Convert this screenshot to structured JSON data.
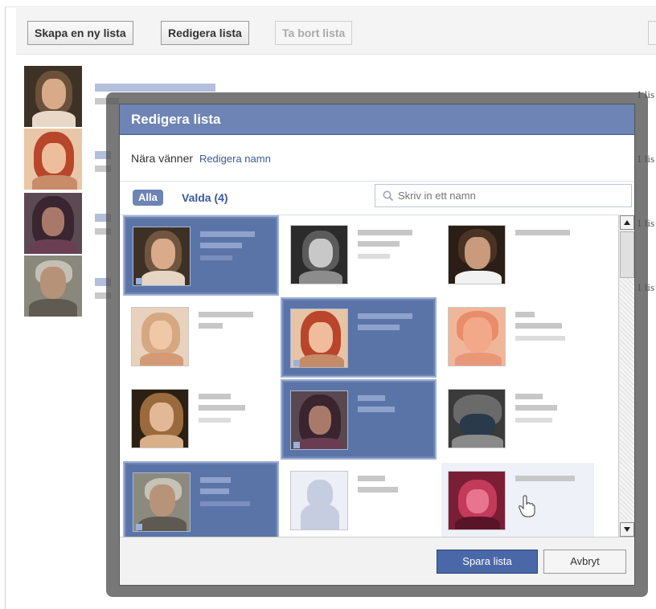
{
  "toolbar": {
    "create_label": "Skapa en ny lista",
    "edit_label": "Redigera lista",
    "delete_label": "Ta bort lista"
  },
  "background_list": {
    "counts": [
      "1 lis",
      "1 lis",
      "1 lis",
      "1 lis"
    ]
  },
  "dialog": {
    "title": "Redigera lista",
    "list_name": "Nära vänner",
    "rename_link": "Redigera namn",
    "filter_all": "Alla",
    "filter_selected": "Valda (4)",
    "search_placeholder": "Skriv in ett namn",
    "save_label": "Spara lista",
    "cancel_label": "Avbryt"
  },
  "friends": [
    {
      "selected": true
    },
    {
      "selected": false
    },
    {
      "selected": false
    },
    {
      "selected": false
    },
    {
      "selected": true
    },
    {
      "selected": false
    },
    {
      "selected": false
    },
    {
      "selected": true
    },
    {
      "selected": false
    },
    {
      "selected": true
    },
    {
      "selected": false
    },
    {
      "selected": false,
      "hovered": true
    }
  ]
}
